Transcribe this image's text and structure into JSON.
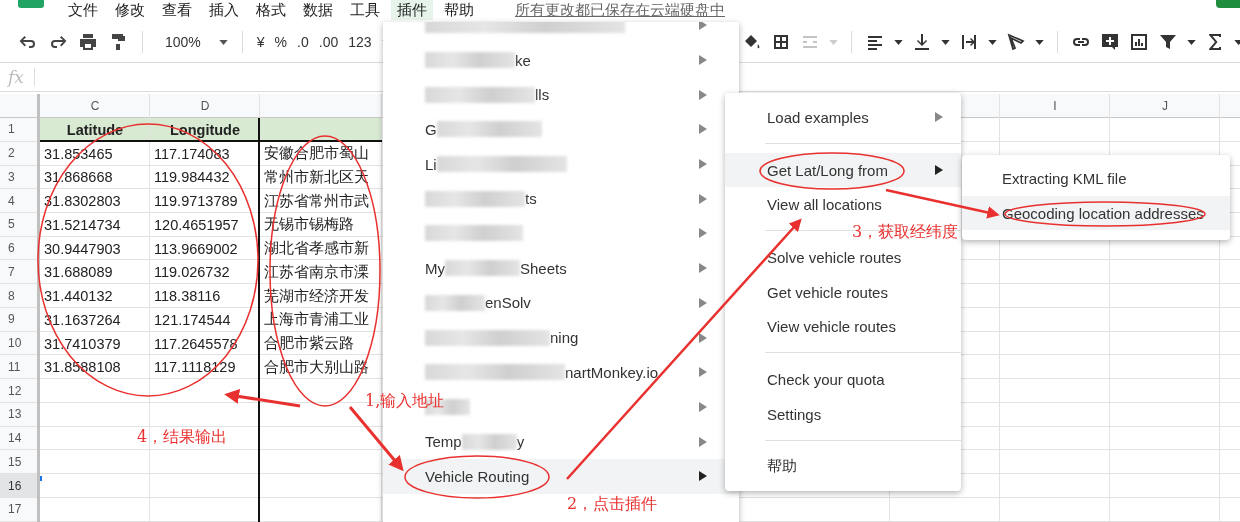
{
  "menubar": {
    "items": [
      {
        "label": "文件",
        "selected": false
      },
      {
        "label": "修改",
        "selected": false
      },
      {
        "label": "查看",
        "selected": false
      },
      {
        "label": "插入",
        "selected": false
      },
      {
        "label": "格式",
        "selected": false
      },
      {
        "label": "数据",
        "selected": false
      },
      {
        "label": "工具",
        "selected": false
      },
      {
        "label": "插件",
        "selected": true
      },
      {
        "label": "帮助",
        "selected": false
      }
    ],
    "save_status": "所有更改都已保存在云端硬盘中"
  },
  "toolbar": {
    "zoom": "100%",
    "currency": "¥",
    "percent": "%",
    "decrease_decimals": ".0",
    "increase_decimals": ".00",
    "number_format": "123"
  },
  "formula_bar": {
    "label": "fx"
  },
  "sheet": {
    "columns_left": [
      "C",
      "D"
    ],
    "columns_right": [
      "I",
      "J"
    ],
    "row_numbers": [
      {
        "label": "1",
        "selected": false
      },
      {
        "label": "2",
        "selected": false
      },
      {
        "label": "3",
        "selected": false
      },
      {
        "label": "4",
        "selected": false
      },
      {
        "label": "5",
        "selected": false
      },
      {
        "label": "6",
        "selected": false
      },
      {
        "label": "7",
        "selected": false
      },
      {
        "label": "8",
        "selected": false
      },
      {
        "label": "9",
        "selected": false
      },
      {
        "label": "10",
        "selected": false
      },
      {
        "label": "11",
        "selected": false
      },
      {
        "label": "12",
        "selected": false
      },
      {
        "label": "13",
        "selected": false
      },
      {
        "label": "14",
        "selected": false
      },
      {
        "label": "15",
        "selected": false
      },
      {
        "label": "16",
        "selected": true
      },
      {
        "label": "17",
        "selected": false
      }
    ],
    "header": [
      "Latitude",
      "Longitude"
    ],
    "rows": [
      {
        "lat": "31.853465",
        "lng": "117.174083",
        "address": "安徽合肥市蜀山"
      },
      {
        "lat": "31.868668",
        "lng": "119.984432",
        "address": "常州市新北区天"
      },
      {
        "lat": "31.8302803",
        "lng": "119.9713789",
        "address": "江苏省常州市武"
      },
      {
        "lat": "31.5214734",
        "lng": "120.4651957",
        "address": "无锡市锡梅路"
      },
      {
        "lat": "30.9447903",
        "lng": "113.9669002",
        "address": "湖北省孝感市新"
      },
      {
        "lat": "31.688089",
        "lng": "119.026732",
        "address": "江苏省南京市溧"
      },
      {
        "lat": "31.440132",
        "lng": "118.38116",
        "address": "芜湖市经济开发"
      },
      {
        "lat": "31.1637264",
        "lng": "121.174544",
        "address": "上海市青浦工业"
      },
      {
        "lat": "31.7410379",
        "lng": "117.2645578",
        "address": "合肥市紫云路"
      },
      {
        "lat": "31.8588108",
        "lng": "117.1118129",
        "address": "合肥市大别山路"
      }
    ]
  },
  "plugins_menu": {
    "items": [
      {
        "kind": "blurred",
        "selected": false
      },
      {
        "kind": "blurred",
        "after": "ke",
        "selected": false
      },
      {
        "kind": "blurred",
        "after": "lls",
        "selected": false
      },
      {
        "kind": "blurred",
        "before": "G",
        "selected": false
      },
      {
        "kind": "blurred",
        "before": "Li",
        "selected": false
      },
      {
        "kind": "blurred",
        "after": "ts",
        "selected": false
      },
      {
        "kind": "blurred",
        "selected": false
      },
      {
        "kind": "blurred",
        "before": "My",
        "after": "Sheets",
        "selected": false
      },
      {
        "kind": "blurred",
        "after": "enSolv",
        "selected": false
      },
      {
        "kind": "blurred",
        "after": "ning",
        "selected": false
      },
      {
        "kind": "blurred",
        "after": "nartMonkey.io",
        "selected": false
      },
      {
        "kind": "blurred",
        "selected": false
      },
      {
        "kind": "blurred",
        "before": "Temp",
        "after": "y",
        "selected": false
      },
      {
        "kind": "plain",
        "label": "Vehicle Routing",
        "selected": true
      }
    ]
  },
  "vehicle_routing_menu": {
    "items": [
      {
        "kind": "item",
        "label": "Load examples",
        "submenu": true,
        "selected": false
      },
      {
        "kind": "separator"
      },
      {
        "kind": "item",
        "label": "Get Lat/Long from",
        "submenu": true,
        "selected": true
      },
      {
        "kind": "item",
        "label": "View all locations",
        "submenu": false,
        "selected": false
      },
      {
        "kind": "separator"
      },
      {
        "kind": "item",
        "label": "Solve vehicle routes",
        "submenu": false,
        "selected": false
      },
      {
        "kind": "item",
        "label": "Get vehicle routes",
        "submenu": false,
        "selected": false
      },
      {
        "kind": "item",
        "label": "View vehicle routes",
        "submenu": false,
        "selected": false
      },
      {
        "kind": "separator"
      },
      {
        "kind": "item",
        "label": "Check your quota",
        "submenu": false,
        "selected": false
      },
      {
        "kind": "item",
        "label": "Settings",
        "submenu": false,
        "selected": false
      },
      {
        "kind": "separator"
      },
      {
        "kind": "item",
        "label": "帮助",
        "submenu": false,
        "selected": false
      }
    ]
  },
  "lat_long_menu": {
    "items": [
      {
        "label": "Extracting KML file",
        "selected": false
      },
      {
        "label": "Geocoding location addresses",
        "selected": true
      }
    ]
  },
  "annotations": [
    {
      "label": "1,输入地址"
    },
    {
      "label": "2，点击插件"
    },
    {
      "label": "3，获取经纬度"
    },
    {
      "label": "4，结果输出"
    }
  ]
}
